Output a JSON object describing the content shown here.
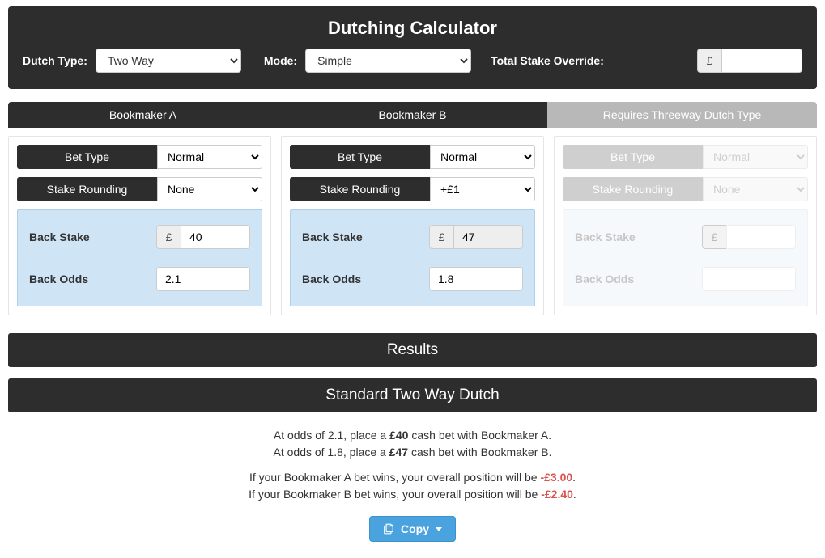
{
  "header": {
    "title": "Dutching Calculator",
    "dutch_type_label": "Dutch Type:",
    "dutch_type_value": "Two Way",
    "mode_label": "Mode:",
    "mode_value": "Simple",
    "stake_override_label": "Total Stake Override:",
    "currency": "£",
    "stake_override_value": ""
  },
  "tabs": {
    "a": "Bookmaker A",
    "b": "Bookmaker B",
    "c": "Requires Threeway Dutch Type"
  },
  "columns": {
    "a": {
      "bet_type_label": "Bet Type",
      "bet_type_value": "Normal",
      "rounding_label": "Stake Rounding",
      "rounding_value": "None",
      "back_stake_label": "Back Stake",
      "back_stake_currency": "£",
      "back_stake_value": "40",
      "back_odds_label": "Back Odds",
      "back_odds_value": "2.1"
    },
    "b": {
      "bet_type_label": "Bet Type",
      "bet_type_value": "Normal",
      "rounding_label": "Stake Rounding",
      "rounding_value": "+£1",
      "back_stake_label": "Back Stake",
      "back_stake_currency": "£",
      "back_stake_value": "47",
      "back_odds_label": "Back Odds",
      "back_odds_value": "1.8"
    },
    "c": {
      "bet_type_label": "Bet Type",
      "bet_type_value": "Normal",
      "rounding_label": "Stake Rounding",
      "rounding_value": "None",
      "back_stake_label": "Back Stake",
      "back_stake_currency": "£",
      "back_stake_value": "",
      "back_odds_label": "Back Odds",
      "back_odds_value": ""
    }
  },
  "results": {
    "results_title": "Results",
    "section_title": "Standard Two Way Dutch",
    "line1_pre": "At odds of 2.1, place a ",
    "line1_bold": "£40",
    "line1_post": " cash bet with Bookmaker A.",
    "line2_pre": "At odds of 1.8, place a ",
    "line2_bold": "£47",
    "line2_post": " cash bet with Bookmaker B.",
    "line3_pre": "If your Bookmaker A bet wins, your overall position will be ",
    "line3_val": "-£3.00",
    "line3_post": ".",
    "line4_pre": "If your Bookmaker B bet wins, your overall position will be ",
    "line4_val": "-£2.40",
    "line4_post": ".",
    "copy_label": "Copy"
  }
}
